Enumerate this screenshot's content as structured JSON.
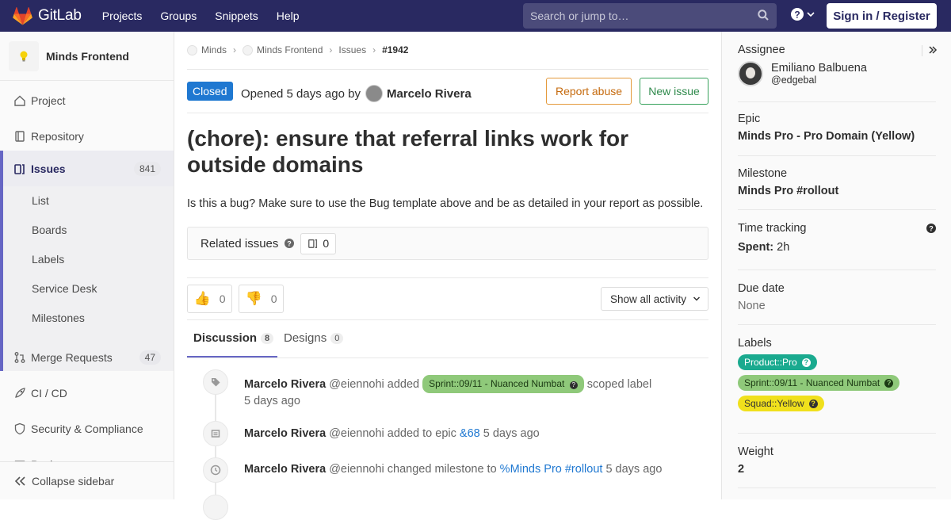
{
  "topnav": {
    "brand": "GitLab",
    "links": [
      "Projects",
      "Groups",
      "Snippets",
      "Help"
    ],
    "search_placeholder": "Search or jump to…",
    "signin_label": "Sign in / Register"
  },
  "sidebar": {
    "project_name": "Minds Frontend",
    "items": {
      "project": "Project",
      "repository": "Repository",
      "issues": "Issues",
      "issues_count": "841",
      "merge_requests": "Merge Requests",
      "mr_count": "47",
      "cicd": "CI / CD",
      "security": "Security & Compliance",
      "packages_partial": "Pack"
    },
    "subitems": [
      "List",
      "Boards",
      "Labels",
      "Service Desk",
      "Milestones"
    ],
    "collapse_label": "Collapse sidebar"
  },
  "breadcrumbs": [
    "Minds",
    "Minds Frontend",
    "Issues",
    "#1942"
  ],
  "issue": {
    "status": "Closed",
    "opened_text": "Opened 5 days ago by",
    "author": "Marcelo Rivera",
    "report_abuse": "Report abuse",
    "new_issue": "New issue",
    "title": "(chore): ensure that referral links work for outside domains",
    "description": "Is this a bug? Make sure to use the Bug template above and be as detailed in your report as possible.",
    "related_label": "Related issues",
    "related_count": "0",
    "thumbs_up": "0",
    "thumbs_down": "0",
    "activity_filter": "Show all activity",
    "tabs": [
      {
        "label": "Discussion",
        "count": "8"
      },
      {
        "label": "Designs",
        "count": "0"
      }
    ]
  },
  "timeline": [
    {
      "author": "Marcelo Rivera",
      "handle": "@eiennohi",
      "action": "added",
      "label": "Sprint::09/11 - Nuanced Numbat",
      "suffix": "scoped label",
      "time": "5 days ago"
    },
    {
      "author": "Marcelo Rivera",
      "handle": "@eiennohi",
      "action": "added to epic",
      "link": "&68",
      "time": "5 days ago"
    },
    {
      "author": "Marcelo Rivera",
      "handle": "@eiennohi",
      "action": "changed milestone to",
      "link": "%Minds Pro #rollout",
      "time": "5 days ago"
    }
  ],
  "right_sidebar": {
    "assignee_label": "Assignee",
    "assignee_name": "Emiliano Balbuena",
    "assignee_handle": "@edgebal",
    "epic_label": "Epic",
    "epic_value": "Minds Pro - Pro Domain (Yellow)",
    "milestone_label": "Milestone",
    "milestone_value": "Minds Pro #rollout",
    "time_label": "Time tracking",
    "spent_label": "Spent:",
    "spent_value": "2h",
    "due_label": "Due date",
    "due_value": "None",
    "labels_label": "Labels",
    "labels": [
      {
        "text": "Product::Pro",
        "color": "#1aaa8f"
      },
      {
        "text": "Sprint::09/11 - Nuanced Numbat",
        "color": "#8fc97a"
      },
      {
        "text": "Squad::Yellow",
        "color": "#f0e01c"
      }
    ],
    "weight_label": "Weight",
    "weight_value": "2"
  }
}
